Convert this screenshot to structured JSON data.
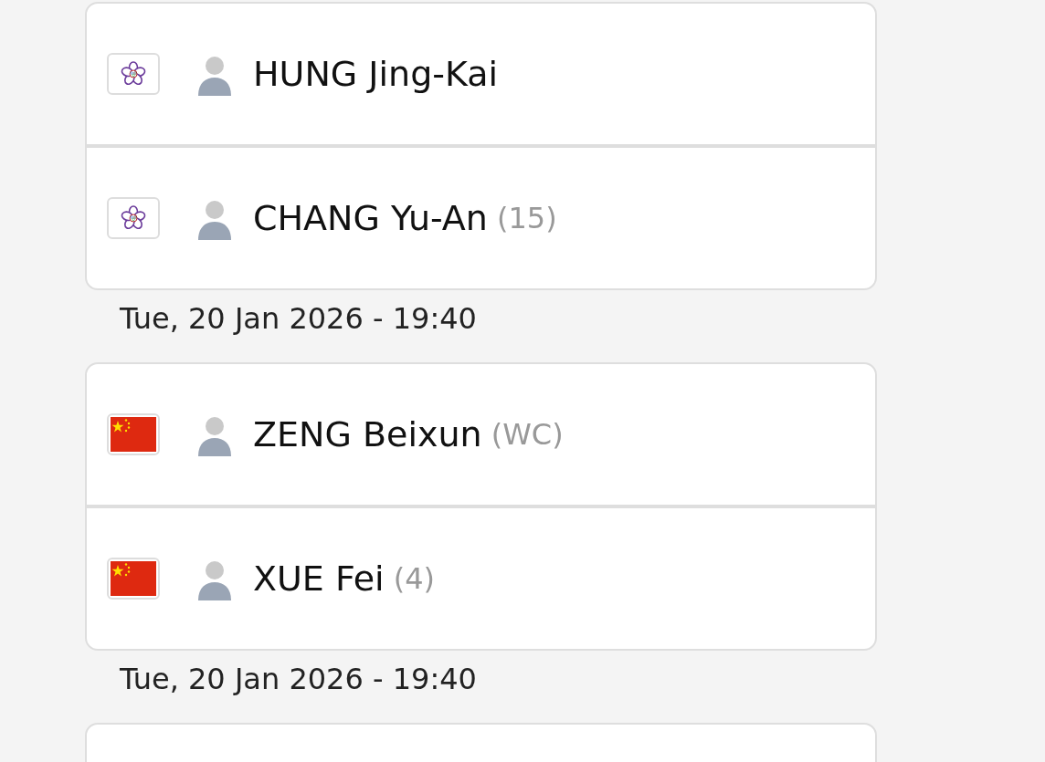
{
  "matches": [
    {
      "players": [
        {
          "kind": "tpe",
          "name": "HUNG Jing-Kai"
        },
        {
          "kind": "tpe",
          "name": "CHANG Yu-An",
          "seed": "(15)"
        }
      ],
      "date": "Tue, 20 Jan 2026 - 19:40"
    },
    {
      "players": [
        {
          "kind": "chn",
          "name": "ZENG Beixun",
          "seed": "(WC)"
        },
        {
          "kind": "chn",
          "name": "XUE Fei",
          "seed": "(4)"
        }
      ],
      "date": "Tue, 20 Jan 2026 - 19:40"
    }
  ]
}
